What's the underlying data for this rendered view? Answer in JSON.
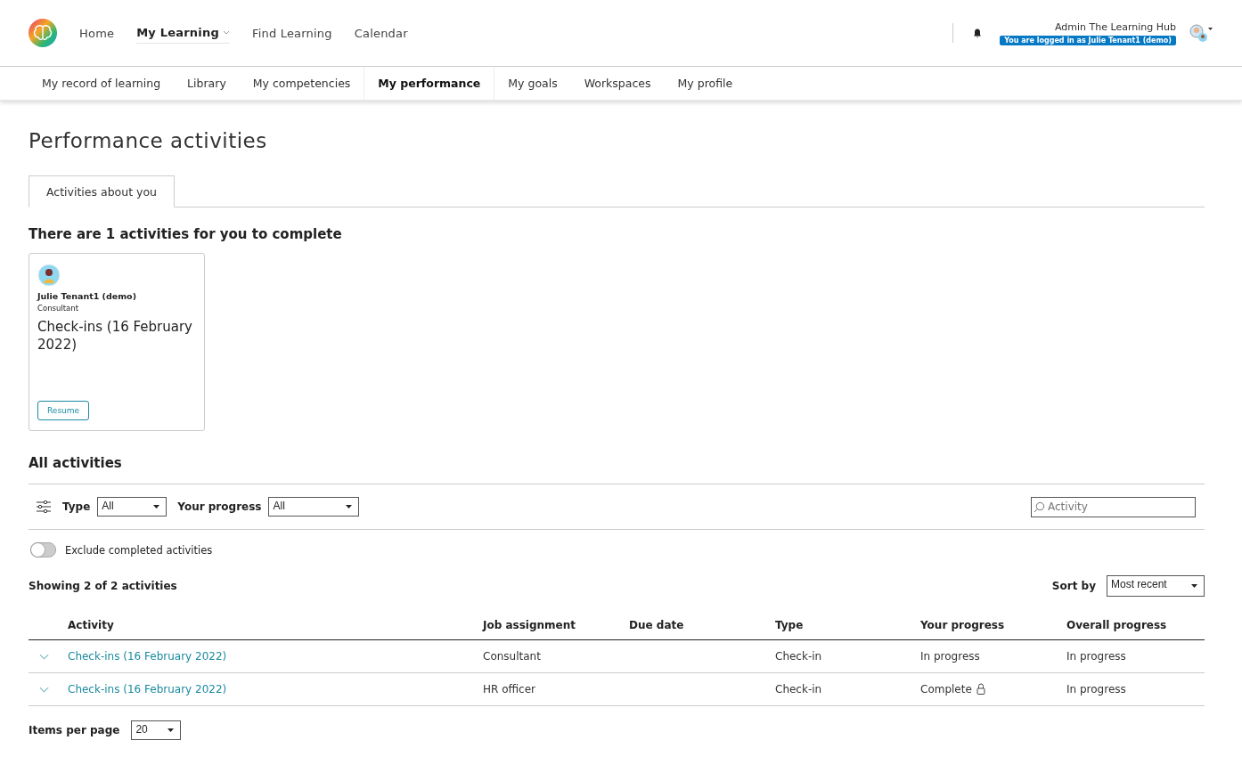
{
  "top_nav": [
    {
      "label": "Home",
      "selected": false,
      "has_menu": false
    },
    {
      "label": "My Learning",
      "selected": true,
      "has_menu": true
    },
    {
      "label": "Find Learning",
      "selected": false,
      "has_menu": false
    },
    {
      "label": "Calendar",
      "selected": false,
      "has_menu": false
    }
  ],
  "user": {
    "name": "Admin The Learning Hub",
    "login_badge": "You are logged in as Julie Tenant1 (demo)"
  },
  "sub_nav": [
    {
      "label": "My record of learning",
      "selected": false
    },
    {
      "label": "Library",
      "selected": false
    },
    {
      "label": "My competencies",
      "selected": false
    },
    {
      "label": "My performance",
      "selected": true
    },
    {
      "label": "My goals",
      "selected": false
    },
    {
      "label": "Workspaces",
      "selected": false
    },
    {
      "label": "My profile",
      "selected": false
    }
  ],
  "page_title": "Performance activities",
  "tabs": [
    {
      "label": "Activities about you",
      "selected": true
    }
  ],
  "to_complete_heading": "There are 1 activities for you to complete",
  "cards": [
    {
      "person": "Julie Tenant1 (demo)",
      "role": "Consultant",
      "title": "Check-ins (16 February 2022)",
      "action": "Resume"
    }
  ],
  "all_heading": "All activities",
  "filters": [
    {
      "label": "Type",
      "value": "All"
    },
    {
      "label": "Your progress",
      "value": "All"
    }
  ],
  "search": {
    "placeholder": "Activity"
  },
  "toggle": {
    "label": "Exclude completed activities",
    "on": false
  },
  "showing": "Showing 2 of 2 activities",
  "sort": {
    "label": "Sort by",
    "value": "Most recent"
  },
  "table": {
    "columns": [
      "Activity",
      "Job assignment",
      "Due date",
      "Type",
      "Your progress",
      "Overall progress"
    ],
    "rows": [
      {
        "activity": "Check-ins (16 February 2022)",
        "job": "Consultant",
        "due": "",
        "type": "Check-in",
        "your_progress": "In progress",
        "locked": false,
        "overall": "In progress"
      },
      {
        "activity": "Check-ins (16 February 2022)",
        "job": "HR officer",
        "due": "",
        "type": "Check-in",
        "your_progress": "Complete",
        "locked": true,
        "overall": "In progress"
      }
    ]
  },
  "pager": {
    "label": "Items per page",
    "value": "20"
  }
}
